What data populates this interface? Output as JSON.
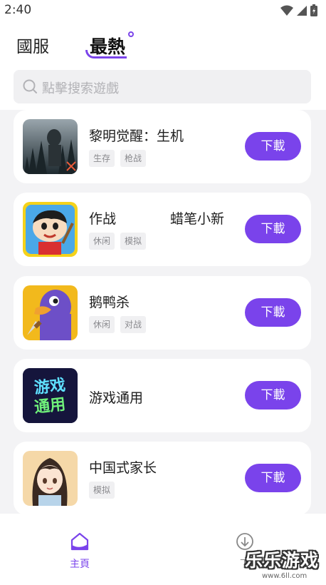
{
  "status_bar": {
    "time": "2:40"
  },
  "tabs": {
    "domestic": "國服",
    "hot": "最熱"
  },
  "search": {
    "placeholder": "點擊搜索遊戲"
  },
  "games": [
    {
      "name": "黎明觉醒：生机",
      "tags": [
        "生存",
        "枪战"
      ],
      "button": "下載",
      "icon": "dark-forest-game-icon"
    },
    {
      "name": "作战　　　　蜡笔小新",
      "tags": [
        "休闲",
        "模拟"
      ],
      "button": "下載",
      "icon": "crayon-shin-chan-icon"
    },
    {
      "name": "鹅鸭杀",
      "tags": [
        "休闲",
        "对战"
      ],
      "button": "下載",
      "icon": "purple-goose-icon"
    },
    {
      "name": "游戏通用",
      "tags": [],
      "button": "下載",
      "icon": "game-universal-text-icon",
      "icon_text": [
        "游戏",
        "通用"
      ]
    },
    {
      "name": "中国式家长",
      "tags": [
        "模拟"
      ],
      "button": "下載",
      "icon": "anime-girl-icon"
    }
  ],
  "bottom_nav": {
    "home": "主頁",
    "downloads": "下"
  },
  "watermark": {
    "text": "乐乐游戏",
    "url": "www.6ll.com"
  },
  "colors": {
    "accent": "#7a43eb",
    "background": "#f3f3f5",
    "card": "#ffffff"
  }
}
